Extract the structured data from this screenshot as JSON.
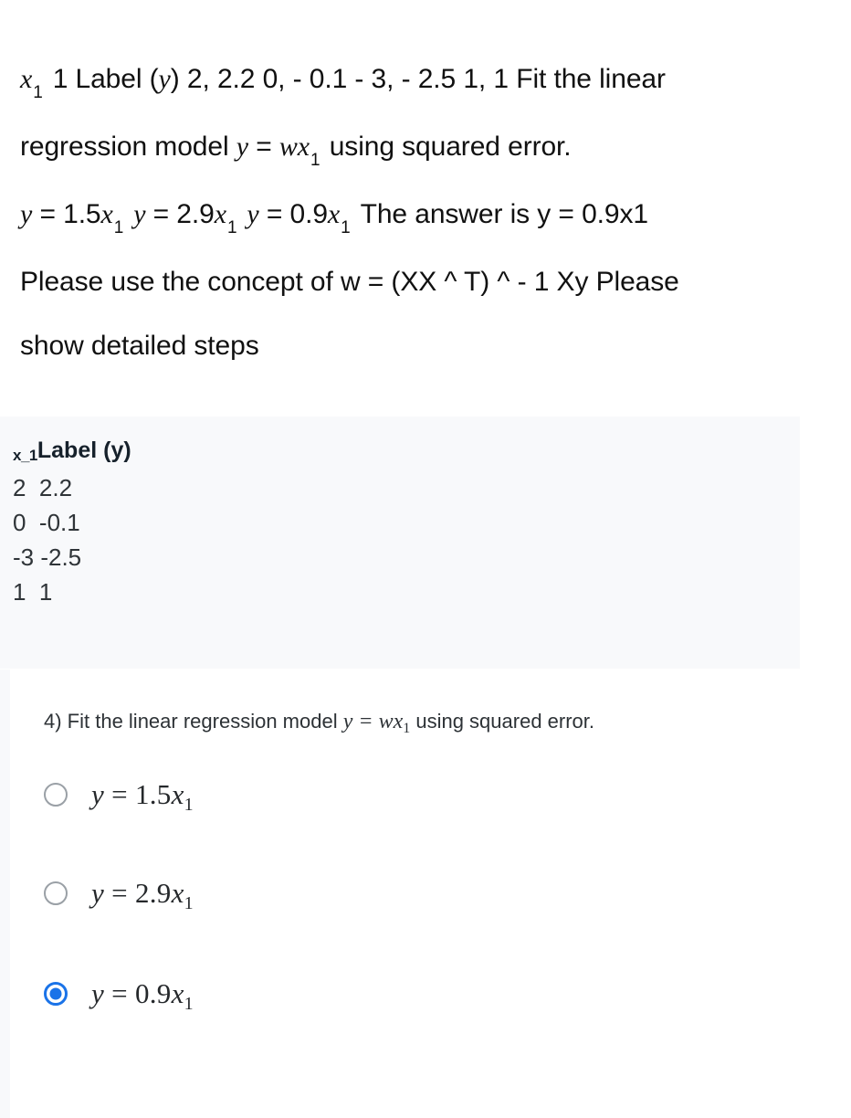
{
  "prose": {
    "line1_var": "x",
    "line1_sub": "1",
    "line1_a": "1 Label (",
    "line1_y": "y",
    "line1_b": ") 2, 2.2 0, - 0.1  - 3, - 2.5 1, 1 Fit the linear",
    "line2_a": "regression model ",
    "line2_y": "y",
    "line2_eq": " = ",
    "line2_w": "wx",
    "line2_sub": "1",
    "line2_b": " using squared error.",
    "line3_y1": "y",
    "line3_e1": " = 1.5",
    "line3_x1": "x",
    "line3_s1": "1",
    "line3_y2": "y",
    "line3_e2": " = 2.9",
    "line3_x2": "x",
    "line3_s2": "1",
    "line3_y3": "y",
    "line3_e3": " = 0.9",
    "line3_x3": "x",
    "line3_s3": "1",
    "line3_tail": "The answer is y = 0.9x1",
    "line4": "Please use the concept of w  =  (XX ^ T) ^ - 1 Xy Please",
    "line5": "show detailed steps"
  },
  "table": {
    "header_x": "x_1",
    "header_label": "Label (y)",
    "rows": [
      "2  2.2",
      "0  -0.1",
      "-3 -2.5",
      "1  1"
    ]
  },
  "question": {
    "number": "4)",
    "text_before": " Fit the linear regression model ",
    "formula_w": "wx",
    "formula_sub": "1",
    "formula_y": "y",
    "formula_eq": " = ",
    "text_after": " using squared error.",
    "options": [
      {
        "y": "y",
        "eq": " = ",
        "coef": "1.5",
        "x": "x",
        "sub": "1",
        "selected": false
      },
      {
        "y": "y",
        "eq": " = ",
        "coef": "2.9",
        "x": "x",
        "sub": "1",
        "selected": false
      },
      {
        "y": "y",
        "eq": " = ",
        "coef": "0.9",
        "x": "x",
        "sub": "1",
        "selected": true
      }
    ],
    "selected_index": 2
  },
  "colors": {
    "accent_blue": "#1a73e8",
    "panel_gray": "#f8f9fb",
    "radio_border": "#9aa0a6",
    "text": "#141414"
  }
}
